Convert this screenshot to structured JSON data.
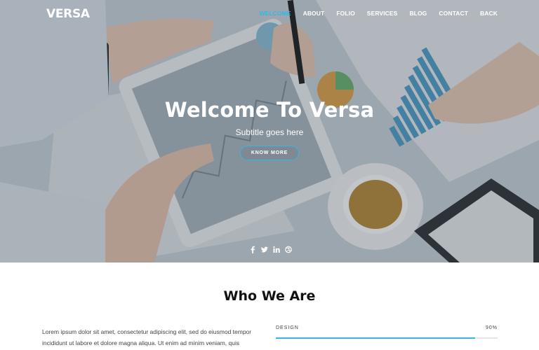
{
  "brand": {
    "logo": "VERSA",
    "accent": "#34b8e6"
  },
  "nav": {
    "items": [
      {
        "label": "WELCOME",
        "active": true
      },
      {
        "label": "ABOUT",
        "active": false
      },
      {
        "label": "FOLIO",
        "active": false
      },
      {
        "label": "SERVICES",
        "active": false
      },
      {
        "label": "BLOG",
        "active": false
      },
      {
        "label": "CONTACT",
        "active": false
      },
      {
        "label": "BACK",
        "active": false
      }
    ]
  },
  "hero": {
    "title": "Welcome To Versa",
    "subtitle": "Subtitle goes here",
    "button_label": "KNOW MORE",
    "social_icons": [
      "facebook-icon",
      "twitter-icon",
      "linkedin-icon",
      "dribbble-icon"
    ]
  },
  "about": {
    "title": "Who We Are",
    "text": "Lorem ipsum dolor sit amet, consectetur adipiscing elit, sed do eiusmod tempor incididunt ut labore et dolore magna aliqua. Ut enim ad minim veniam, quis nostrud",
    "skills": [
      {
        "label": "DESIGN",
        "percent_label": "90%",
        "value": 0.9
      }
    ]
  }
}
